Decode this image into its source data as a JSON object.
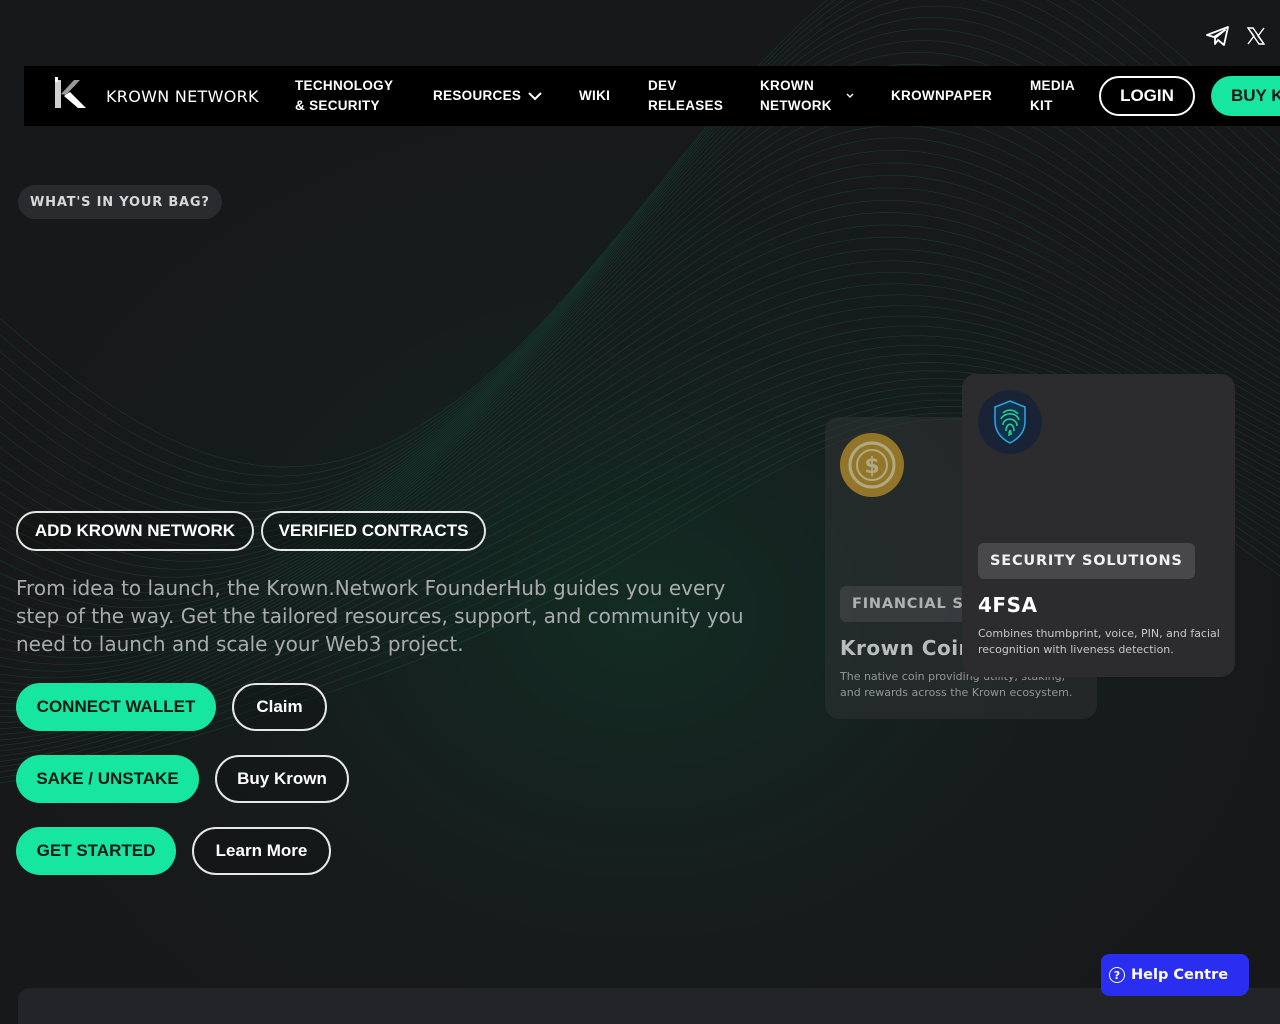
{
  "social": {
    "telegram_icon": "telegram-icon",
    "x_icon": "x-icon"
  },
  "nav": {
    "brand": "KROWN NETWORK",
    "items": [
      {
        "line1": "TECHNOLOGY",
        "line2": "& SECURITY"
      },
      {
        "label": "RESOURCES"
      },
      {
        "label": "WIKI"
      },
      {
        "line1": "DEV",
        "line2": "RELEASES"
      },
      {
        "line1": "KROWN",
        "line2": "NETWORK"
      },
      {
        "label": "KROWNPAPER"
      },
      {
        "line1": "MEDIA",
        "line2": "KIT"
      }
    ],
    "login": "LOGIN",
    "buy": "BUY K"
  },
  "hero": {
    "eyebrow": "WHAT'S IN YOUR BAG?",
    "add_network": "ADD KROWN NETWORK",
    "verified": "VERIFIED CONTRACTS",
    "intro": "From idea to launch, the Krown.Network FounderHub guides you every step of the way. Get the tailored resources, support, and community you need to launch and scale your Web3 project.",
    "connect_wallet": "CONNECT WALLET",
    "claim": "Claim",
    "stake": "SAKE / UNSTAKE",
    "buy_krown": "Buy Krown",
    "get_started": "GET STARTED",
    "learn_more": "Learn More"
  },
  "cards": {
    "back": {
      "badge": "FINANCIAL SE",
      "title": "Krown Coin",
      "desc": "The native coin providing utility, staking, and rewards across the Krown ecosystem."
    },
    "front": {
      "badge": "SECURITY SOLUTIONS",
      "title": "4FSA",
      "desc": "Combines thumbprint, voice, PIN, and facial recognition with liveness detection."
    }
  },
  "help": {
    "label": "Help Centre"
  },
  "colors": {
    "accent": "#16e6a0",
    "background": "#17181a",
    "help": "#2a2ef0"
  }
}
